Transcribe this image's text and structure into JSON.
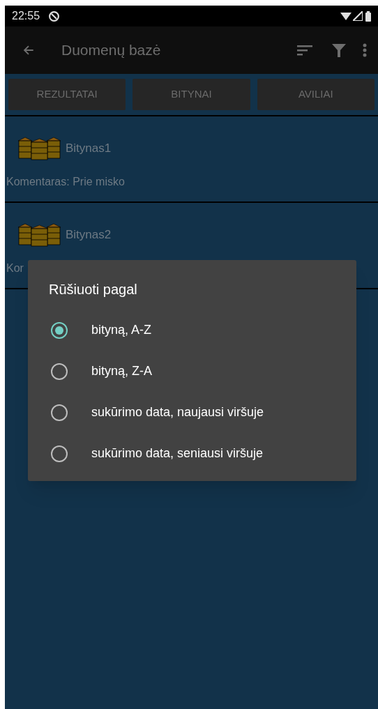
{
  "status_bar": {
    "time": "22:55"
  },
  "app_bar": {
    "title": "Duomenų bazė"
  },
  "tabs": [
    {
      "label": "REZULTATAI"
    },
    {
      "label": "BITYNAI"
    },
    {
      "label": "AVILIAI"
    }
  ],
  "apiaries": [
    {
      "name": "Bitynas1",
      "comment": "Komentaras: Prie misko"
    },
    {
      "name": "Bitynas2",
      "comment": "Kor"
    }
  ],
  "dialog": {
    "title": "Rūšiuoti pagal",
    "options": [
      {
        "label": "bityną, A-Z",
        "selected": true
      },
      {
        "label": "bityną, Z-A",
        "selected": false
      },
      {
        "label": "sukūrimo data, naujausi viršuje",
        "selected": false
      },
      {
        "label": "sukūrimo data, seniausi viršuje",
        "selected": false
      }
    ]
  }
}
